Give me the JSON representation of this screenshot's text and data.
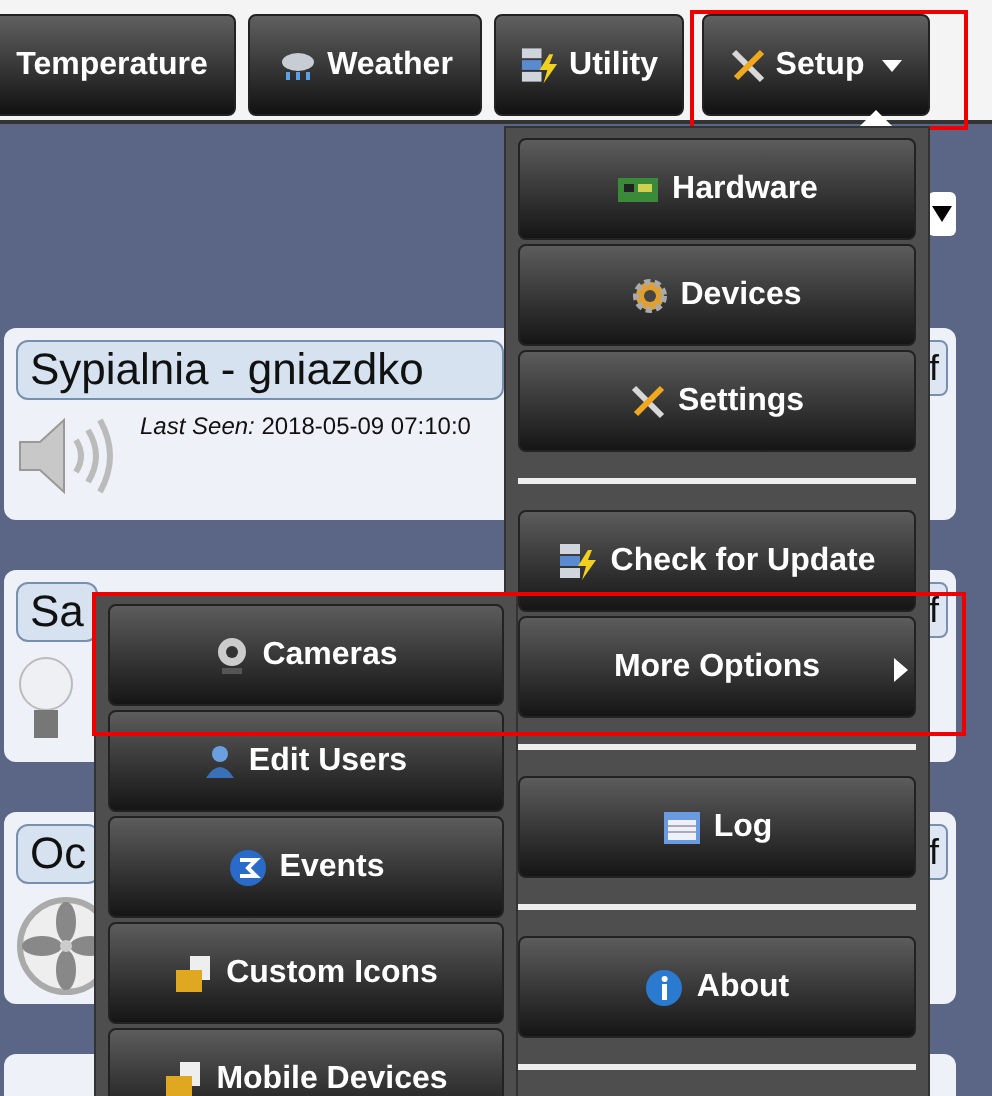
{
  "nav": [
    {
      "label": "Temperature",
      "expanded": false,
      "highlighted": false
    },
    {
      "label": "Weather",
      "expanded": false,
      "highlighted": false
    },
    {
      "label": "Utility",
      "expanded": false,
      "highlighted": false
    },
    {
      "label": "Setup",
      "expanded": true,
      "highlighted": true
    }
  ],
  "cards": [
    {
      "kind": "device",
      "title": "Sypialnia - gniazdko",
      "last_seen_label": "Last Seen:",
      "last_seen": "2018-05-09 07:10:0",
      "switch": "f"
    },
    {
      "kind": "device",
      "title": "Sa",
      "switch": "f"
    },
    {
      "kind": "device",
      "title": "Oc",
      "switch": "f"
    },
    {
      "kind": "device"
    }
  ],
  "menu": [
    {
      "label": "Hardware",
      "divider_after": false
    },
    {
      "label": "Devices",
      "divider_after": false
    },
    {
      "label": "Settings",
      "divider_after": true
    },
    {
      "label": "Check for Update",
      "divider_after": false
    },
    {
      "label": "More Options",
      "divider_after": true,
      "submenu": true,
      "highlighted": true
    },
    {
      "label": "Log",
      "divider_after": true
    },
    {
      "label": "About",
      "divider_after": true
    }
  ],
  "submenu": [
    {
      "label": "Cameras"
    },
    {
      "label": "Edit Users"
    },
    {
      "label": "Events"
    },
    {
      "label": "Custom Icons"
    },
    {
      "label": "Mobile Devices"
    }
  ]
}
